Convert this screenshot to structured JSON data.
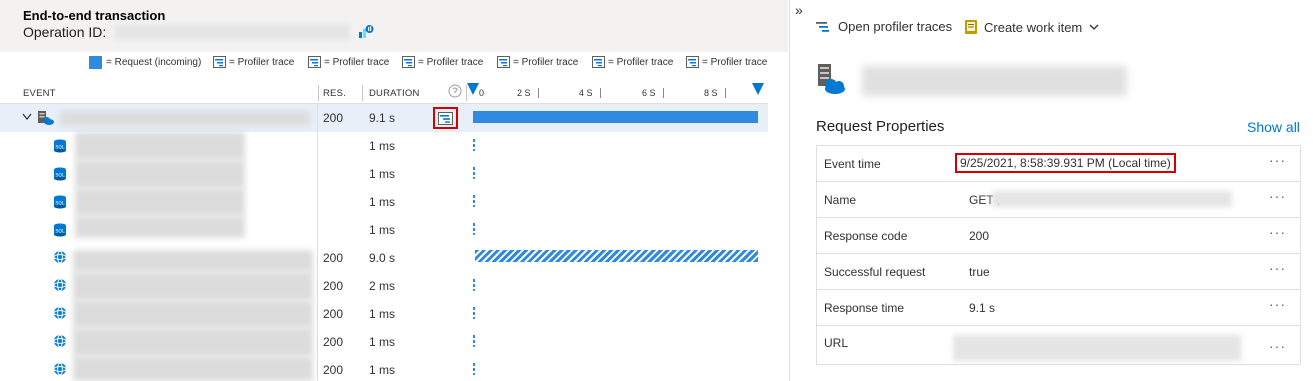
{
  "left_panel": {
    "title": "End-to-end transaction",
    "operation_label": "Operation ID:",
    "legend": {
      "request_label": "= Request (incoming)",
      "profiler_labels": [
        "= Profiler trace",
        "= Profiler trace",
        "= Profiler trace",
        "= Profiler trace",
        "= Profiler trace",
        "= Profiler trace",
        "= Profiler trace"
      ]
    },
    "columns": {
      "event": "EVENT",
      "res": "RES.",
      "duration": "DURATION"
    },
    "timeline_ticks": [
      "0",
      "2 S",
      "4 S",
      "6 S",
      "8 S"
    ],
    "rows": [
      {
        "icon": "server-icon",
        "res": "200",
        "duration": "9.1 s",
        "bar": "solid",
        "bar_fraction": 1.0
      },
      {
        "icon": "sql-icon",
        "res": "",
        "duration": "1 ms",
        "bar": "dash"
      },
      {
        "icon": "sql-icon",
        "res": "",
        "duration": "1 ms",
        "bar": "dash"
      },
      {
        "icon": "sql-icon",
        "res": "",
        "duration": "1 ms",
        "bar": "dash"
      },
      {
        "icon": "sql-icon",
        "res": "",
        "duration": "1 ms",
        "bar": "dash"
      },
      {
        "icon": "dependency-icon",
        "res": "200",
        "duration": "9.0 s",
        "bar": "hatched",
        "bar_fraction": 0.99
      },
      {
        "icon": "dependency-icon",
        "res": "200",
        "duration": "2 ms",
        "bar": "dash"
      },
      {
        "icon": "dependency-icon",
        "res": "200",
        "duration": "1 ms",
        "bar": "dash"
      },
      {
        "icon": "dependency-icon",
        "res": "200",
        "duration": "1 ms",
        "bar": "dash"
      },
      {
        "icon": "dependency-icon",
        "res": "200",
        "duration": "1 ms",
        "bar": "dash"
      }
    ]
  },
  "right_panel": {
    "collapse_glyph": "»",
    "actions": {
      "open_profiler": "Open profiler traces",
      "create_work_item": "Create work item"
    },
    "section_title": "Request Properties",
    "show_all": "Show all",
    "properties": [
      {
        "name": "Event time",
        "value": "9/25/2021, 8:58:39.931 PM (Local time)",
        "highlighted": true
      },
      {
        "name": "Name",
        "value": "GET ,"
      },
      {
        "name": "Response code",
        "value": "200"
      },
      {
        "name": "Successful request",
        "value": "true"
      },
      {
        "name": "Response time",
        "value": "9.1 s"
      },
      {
        "name": "URL",
        "value": ""
      }
    ],
    "more_glyph": "···"
  },
  "colors": {
    "accent": "#2f8ae0",
    "highlight_border": "#d40000",
    "link": "#0078d4",
    "selected_row": "#e8eff8"
  }
}
